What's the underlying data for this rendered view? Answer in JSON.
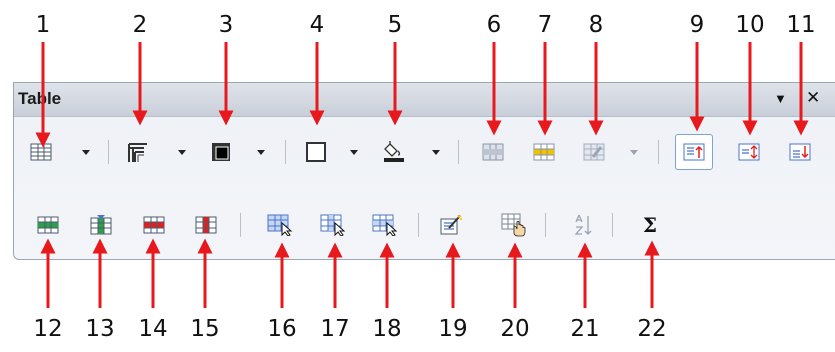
{
  "toolbar": {
    "title": "Table",
    "menu_glyph": "▼",
    "close_glyph": "✕"
  },
  "callouts": {
    "top": [
      "1",
      "2",
      "3",
      "4",
      "5",
      "6",
      "7",
      "8",
      "9",
      "10",
      "11"
    ],
    "bottom": [
      "12",
      "13",
      "14",
      "15",
      "16",
      "17",
      "18",
      "19",
      "20",
      "21",
      "22"
    ]
  },
  "buttons": {
    "sum_glyph": "Σ"
  },
  "colors": {
    "arrow": "#e8191c",
    "grid_blue": "#4b74c9",
    "yellow": "#f2c200",
    "red": "#e02020",
    "green": "#2ea04a"
  },
  "icons": [
    "table-grid-icon",
    "borders-icon",
    "border-style-icon",
    "border-color-icon",
    "background-color-icon",
    "merge-cells-icon",
    "split-cells-icon",
    "optimize-icon",
    "align-top-icon",
    "align-center-icon",
    "align-bottom-icon",
    "insert-rows-icon",
    "insert-columns-icon",
    "delete-rows-icon",
    "delete-columns-icon",
    "select-table-icon",
    "select-column-icon",
    "select-row-icon",
    "autoformat-icon",
    "table-properties-icon",
    "sort-icon",
    "sum-icon"
  ]
}
